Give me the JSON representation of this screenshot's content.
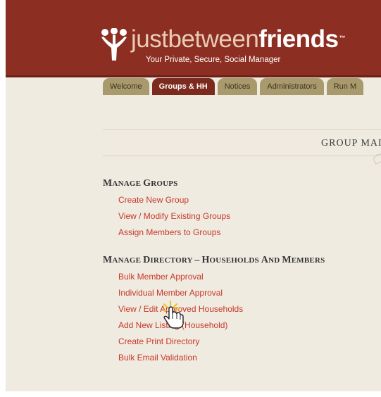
{
  "header": {
    "brand_prefix": "just",
    "brand_middle": "between",
    "brand_suffix": "friends",
    "trademark": "™",
    "tagline": "Your Private, Secure, Social Manager",
    "logo_icon": "three-people-figures-icon",
    "background_color": "#8c2f22"
  },
  "tabs": [
    {
      "label": "Welcome",
      "active": false
    },
    {
      "label": "Groups & HH",
      "active": true
    },
    {
      "label": "Notices",
      "active": false
    },
    {
      "label": "Administrators",
      "active": false
    },
    {
      "label": "Run M",
      "active": false
    }
  ],
  "main": {
    "section_title": "Group Mai",
    "manage_groups": {
      "heading": "Manage Groups",
      "links": [
        "Create New Group",
        "View / Modify Existing Groups",
        "Assign Members to Groups"
      ]
    },
    "manage_directory": {
      "heading": "Manage Directory – Households and Members",
      "links": [
        "Bulk Member Approval",
        "Individual Member Approval",
        "View / Edit Approved Households",
        "Add New Listing (Household)",
        "Create Print Directory",
        "Bulk Email Validation"
      ]
    }
  },
  "cursor": {
    "icon": "hand-pointer-cursor-icon"
  },
  "colors": {
    "link": "#c8372a",
    "tab": "#a89a6c",
    "tab_active": "#7c2a1e",
    "page_background": "#efebe0"
  }
}
